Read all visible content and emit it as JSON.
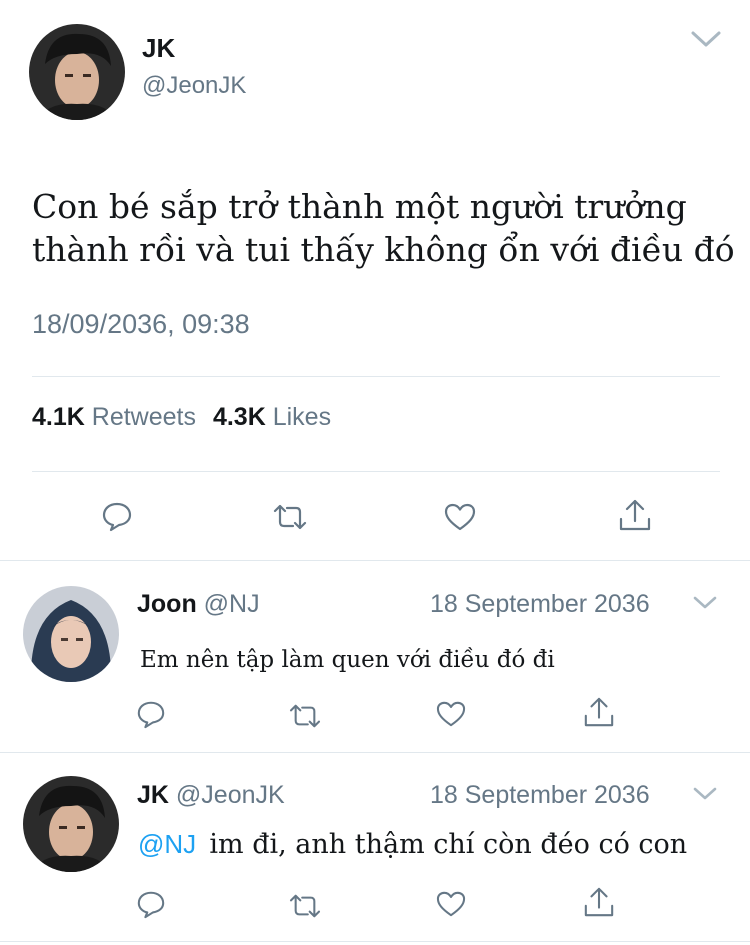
{
  "tweet": {
    "author_name": "JK",
    "author_handle": "@JeonJK",
    "text_line1": "Con bé sắp trở thành một người trưởng",
    "text_line2": "thành rồi và tui thấy không ổn với điều đó",
    "timestamp": "18/09/2036, 09:38",
    "retweet_count": "4.1K",
    "retweet_label": "Retweets",
    "like_count": "4.3K",
    "like_label": "Likes"
  },
  "replies": [
    {
      "author_name": "Joon",
      "author_handle": "@NJ",
      "date": "18 September 2036",
      "text": "Em nên tập làm quen với điều đó đi"
    },
    {
      "author_name": "JK",
      "author_handle": "@JeonJK",
      "date": "18 September 2036",
      "mention": "@NJ",
      "text": "im đi, anh thậm chí còn đéo có con"
    }
  ],
  "icons": {
    "reply": "speech-bubble-icon",
    "retweet": "retweet-arrows-icon",
    "like": "heart-outline-icon",
    "share": "share-upload-icon",
    "menu": "chevron-down-icon"
  },
  "colors": {
    "text": "#14171a",
    "muted": "#657786",
    "link": "#1da1f2",
    "divider": "#e1e8ed"
  }
}
